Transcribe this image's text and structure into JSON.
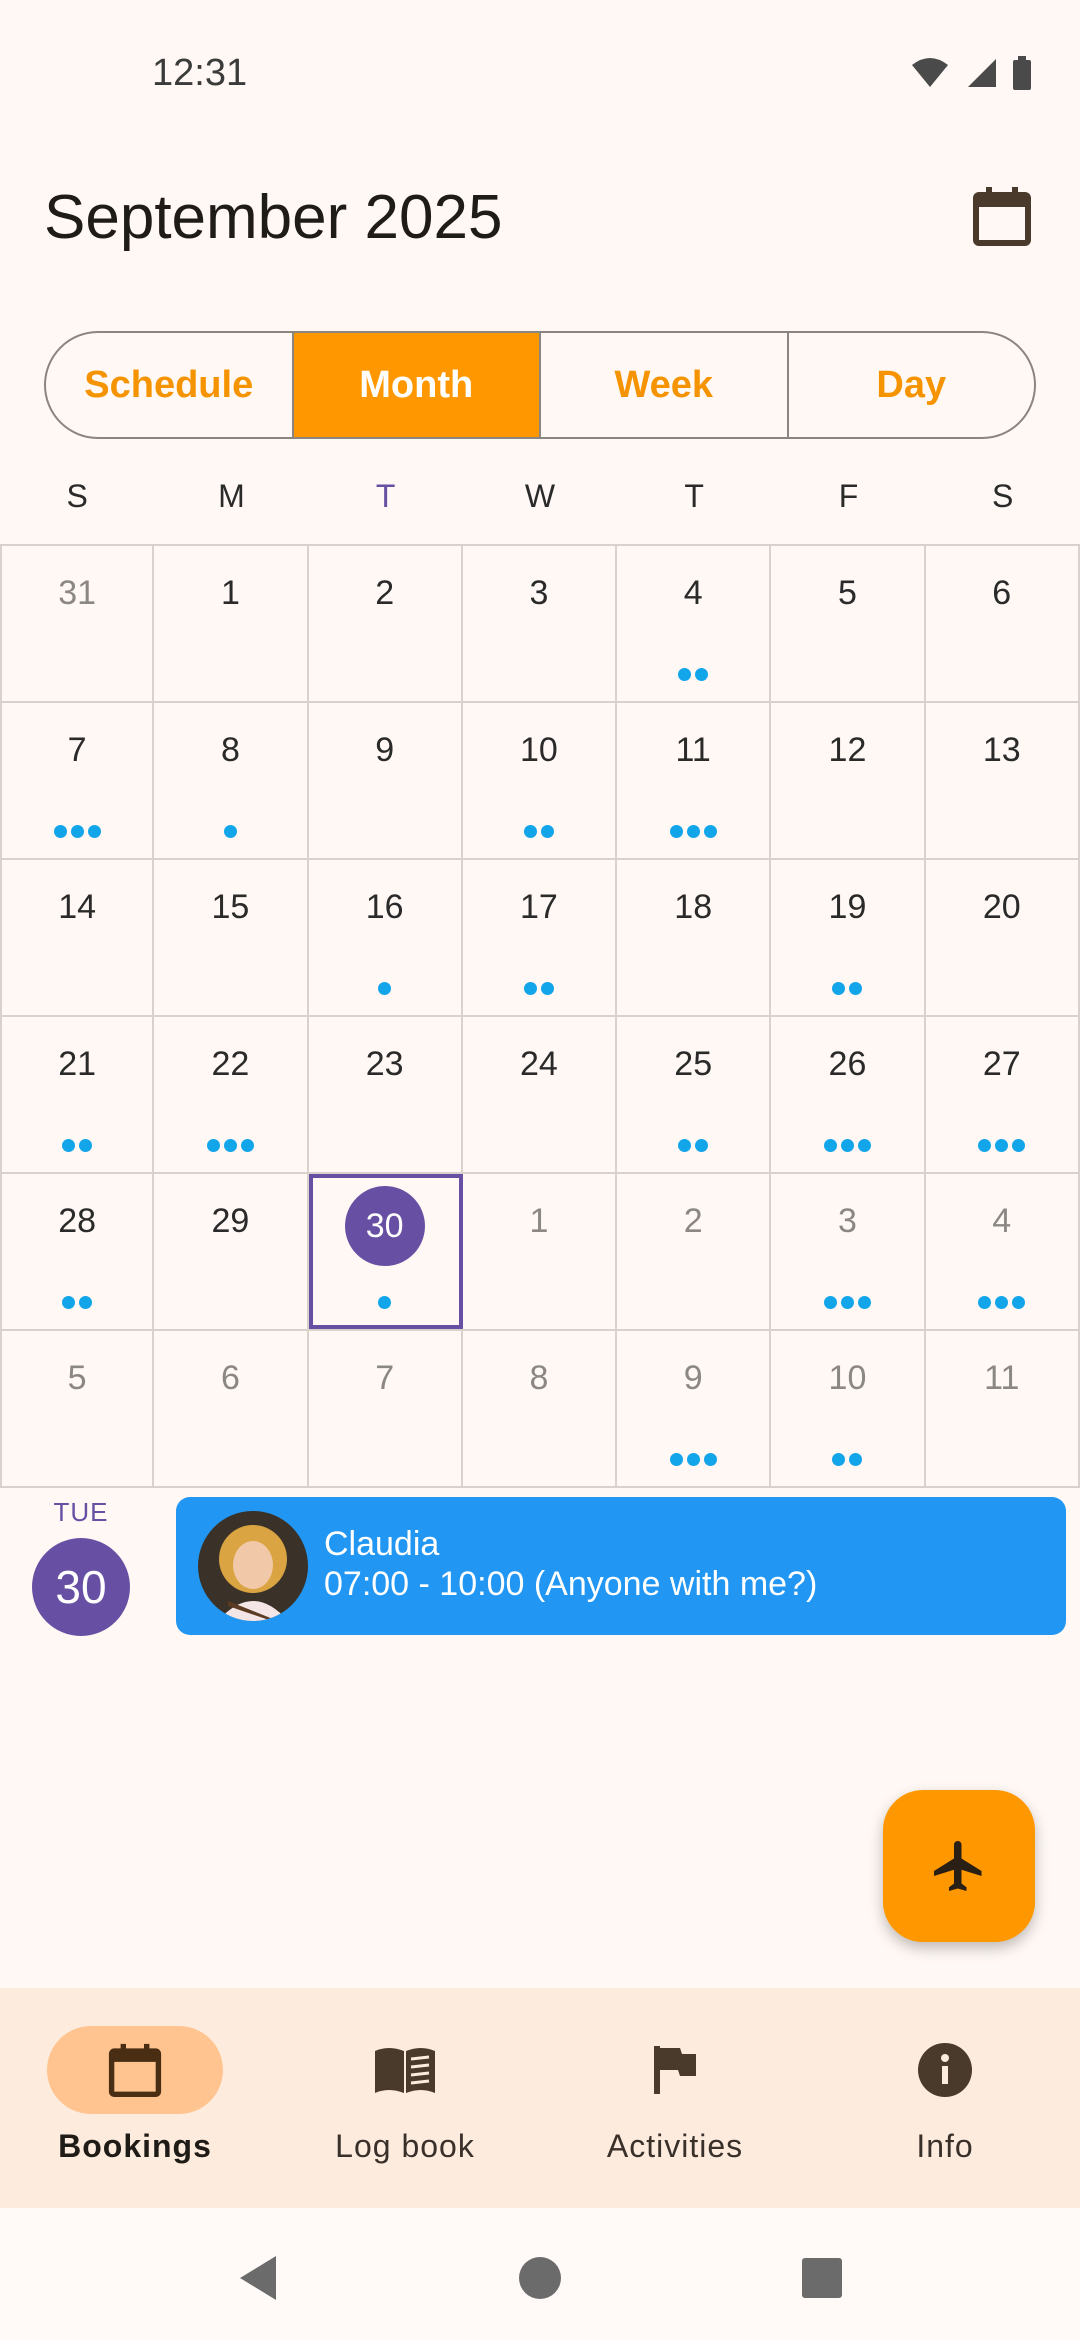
{
  "status_bar": {
    "time": "12:31"
  },
  "header": {
    "title": "September 2025"
  },
  "view_tabs": [
    {
      "label": "Schedule",
      "active": false
    },
    {
      "label": "Month",
      "active": true
    },
    {
      "label": "Week",
      "active": false
    },
    {
      "label": "Day",
      "active": false
    }
  ],
  "weekdays": [
    "S",
    "M",
    "T",
    "W",
    "T",
    "F",
    "S"
  ],
  "today_weekday_index": 2,
  "weeks": [
    [
      {
        "day": "31",
        "muted": true,
        "dots": 0
      },
      {
        "day": "1",
        "dots": 0
      },
      {
        "day": "2",
        "dots": 0
      },
      {
        "day": "3",
        "dots": 0
      },
      {
        "day": "4",
        "dots": 2
      },
      {
        "day": "5",
        "dots": 0
      },
      {
        "day": "6",
        "dots": 0
      }
    ],
    [
      {
        "day": "7",
        "dots": 3
      },
      {
        "day": "8",
        "dots": 1
      },
      {
        "day": "9",
        "dots": 0
      },
      {
        "day": "10",
        "dots": 2
      },
      {
        "day": "11",
        "dots": 3
      },
      {
        "day": "12",
        "dots": 0
      },
      {
        "day": "13",
        "dots": 0
      }
    ],
    [
      {
        "day": "14",
        "dots": 0
      },
      {
        "day": "15",
        "dots": 0
      },
      {
        "day": "16",
        "dots": 1
      },
      {
        "day": "17",
        "dots": 2
      },
      {
        "day": "18",
        "dots": 0
      },
      {
        "day": "19",
        "dots": 2
      },
      {
        "day": "20",
        "dots": 0
      }
    ],
    [
      {
        "day": "21",
        "dots": 2
      },
      {
        "day": "22",
        "dots": 3
      },
      {
        "day": "23",
        "dots": 0
      },
      {
        "day": "24",
        "dots": 0
      },
      {
        "day": "25",
        "dots": 2
      },
      {
        "day": "26",
        "dots": 3
      },
      {
        "day": "27",
        "dots": 3
      }
    ],
    [
      {
        "day": "28",
        "dots": 2
      },
      {
        "day": "29",
        "dots": 0
      },
      {
        "day": "30",
        "dots": 1,
        "selected": true
      },
      {
        "day": "1",
        "muted": true,
        "dots": 0
      },
      {
        "day": "2",
        "muted": true,
        "dots": 0
      },
      {
        "day": "3",
        "muted": true,
        "dots": 3
      },
      {
        "day": "4",
        "muted": true,
        "dots": 3
      }
    ],
    [
      {
        "day": "5",
        "muted": true,
        "dots": 0
      },
      {
        "day": "6",
        "muted": true,
        "dots": 0
      },
      {
        "day": "7",
        "muted": true,
        "dots": 0
      },
      {
        "day": "8",
        "muted": true,
        "dots": 0
      },
      {
        "day": "9",
        "muted": true,
        "dots": 3
      },
      {
        "day": "10",
        "muted": true,
        "dots": 2
      },
      {
        "day": "11",
        "muted": true,
        "dots": 0
      }
    ]
  ],
  "agenda": {
    "weekday": "TUE",
    "date": "30",
    "event": {
      "name": "Claudia",
      "time": "07:00 - 10:00 (Anyone with me?)"
    }
  },
  "fab": {
    "icon": "airplane-icon"
  },
  "bottom_nav": [
    {
      "label": "Bookings",
      "icon": "calendar-icon",
      "active": true
    },
    {
      "label": "Log book",
      "icon": "book-icon",
      "active": false
    },
    {
      "label": "Activities",
      "icon": "flag-icon",
      "active": false
    },
    {
      "label": "Info",
      "icon": "info-icon",
      "active": false
    }
  ],
  "colors": {
    "accent": "#FF9800",
    "primary": "#6750A4",
    "event": "#2196F3",
    "dot": "#12A5EA",
    "background": "#FFF8F4"
  }
}
